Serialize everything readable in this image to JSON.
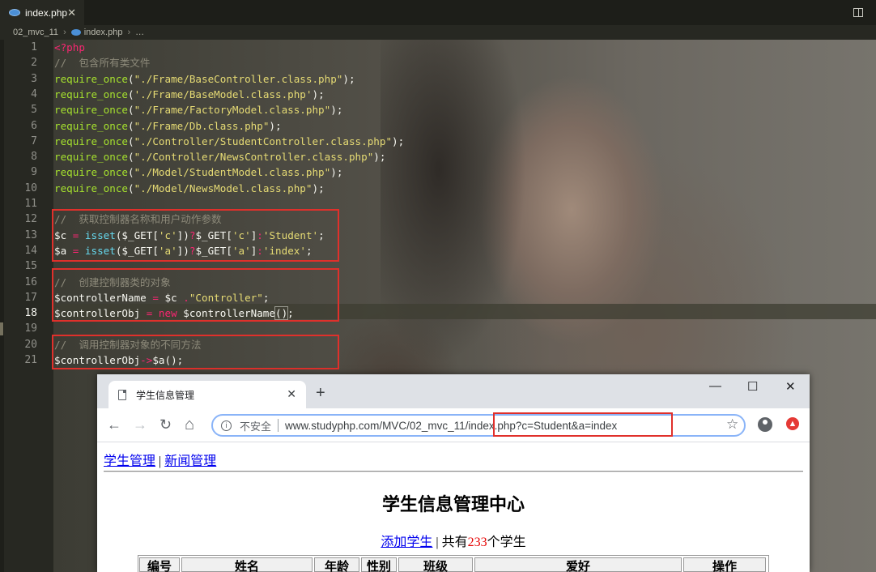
{
  "editor": {
    "tab_title": "index.php",
    "tab_close": "✕",
    "breadcrumb": {
      "folder": "02_mvc_11",
      "file": "index.php",
      "more": "…"
    },
    "lines": [
      {
        "n": "1",
        "tokens": [
          [
            "k-tag",
            "<?php"
          ]
        ]
      },
      {
        "n": "2",
        "tokens": [
          [
            "k-cm",
            "//  包含所有类文件"
          ]
        ]
      },
      {
        "n": "3",
        "tokens": [
          [
            "k-fn",
            "require_once"
          ],
          [
            "k-pn",
            "("
          ],
          [
            "k-str",
            "\"./Frame/BaseController.class.php\""
          ],
          [
            "k-pn",
            ");"
          ]
        ]
      },
      {
        "n": "4",
        "tokens": [
          [
            "k-fn",
            "require_once"
          ],
          [
            "k-pn",
            "("
          ],
          [
            "k-str",
            "'./Frame/BaseModel.class.php'"
          ],
          [
            "k-pn",
            ");"
          ]
        ]
      },
      {
        "n": "5",
        "tokens": [
          [
            "k-fn",
            "require_once"
          ],
          [
            "k-pn",
            "("
          ],
          [
            "k-str",
            "\"./Frame/FactoryModel.class.php\""
          ],
          [
            "k-pn",
            ");"
          ]
        ]
      },
      {
        "n": "6",
        "tokens": [
          [
            "k-fn",
            "require_once"
          ],
          [
            "k-pn",
            "("
          ],
          [
            "k-str",
            "\"./Frame/Db.class.php\""
          ],
          [
            "k-pn",
            ");"
          ]
        ]
      },
      {
        "n": "7",
        "tokens": [
          [
            "k-fn",
            "require_once"
          ],
          [
            "k-pn",
            "("
          ],
          [
            "k-str",
            "\"./Controller/StudentController.class.php\""
          ],
          [
            "k-pn",
            ");"
          ]
        ]
      },
      {
        "n": "8",
        "tokens": [
          [
            "k-fn",
            "require_once"
          ],
          [
            "k-pn",
            "("
          ],
          [
            "k-str",
            "\"./Controller/NewsController.class.php\""
          ],
          [
            "k-pn",
            ");"
          ]
        ]
      },
      {
        "n": "9",
        "tokens": [
          [
            "k-fn",
            "require_once"
          ],
          [
            "k-pn",
            "("
          ],
          [
            "k-str",
            "\"./Model/StudentModel.class.php\""
          ],
          [
            "k-pn",
            ");"
          ]
        ]
      },
      {
        "n": "10",
        "tokens": [
          [
            "k-fn",
            "require_once"
          ],
          [
            "k-pn",
            "("
          ],
          [
            "k-str",
            "\"./Model/NewsModel.class.php\""
          ],
          [
            "k-pn",
            ");"
          ]
        ]
      },
      {
        "n": "11",
        "tokens": []
      },
      {
        "n": "12",
        "tokens": [
          [
            "k-cm",
            "//  获取控制器名称和用户动作参数"
          ]
        ]
      },
      {
        "n": "13",
        "tokens": [
          [
            "k-var",
            "$c"
          ],
          [
            "k-op",
            " = "
          ],
          [
            "k-bi",
            "isset"
          ],
          [
            "k-pn",
            "($_GET["
          ],
          [
            "k-str",
            "'c'"
          ],
          [
            "k-pn",
            "])"
          ],
          [
            "k-op",
            "?"
          ],
          [
            "k-pn",
            "$_GET["
          ],
          [
            "k-str",
            "'c'"
          ],
          [
            "k-pn",
            "]"
          ],
          [
            "k-op",
            ":"
          ],
          [
            "k-str",
            "'Student'"
          ],
          [
            "k-pn",
            ";"
          ]
        ]
      },
      {
        "n": "14",
        "tokens": [
          [
            "k-var",
            "$a"
          ],
          [
            "k-op",
            " = "
          ],
          [
            "k-bi",
            "isset"
          ],
          [
            "k-pn",
            "($_GET["
          ],
          [
            "k-str",
            "'a'"
          ],
          [
            "k-pn",
            "])"
          ],
          [
            "k-op",
            "?"
          ],
          [
            "k-pn",
            "$_GET["
          ],
          [
            "k-str",
            "'a'"
          ],
          [
            "k-pn",
            "]"
          ],
          [
            "k-op",
            ":"
          ],
          [
            "k-str",
            "'index'"
          ],
          [
            "k-pn",
            ";"
          ]
        ]
      },
      {
        "n": "15",
        "tokens": []
      },
      {
        "n": "16",
        "tokens": [
          [
            "k-cm",
            "//  创建控制器类的对象"
          ]
        ]
      },
      {
        "n": "17",
        "tokens": [
          [
            "k-var",
            "$controllerName"
          ],
          [
            "k-op",
            " = "
          ],
          [
            "k-var",
            "$c"
          ],
          [
            "k-op",
            " ."
          ],
          [
            "k-str",
            "\"Controller\""
          ],
          [
            "k-pn",
            ";"
          ]
        ]
      },
      {
        "n": "18",
        "tokens": [
          [
            "k-var",
            "$controllerObj"
          ],
          [
            "k-op",
            " = "
          ],
          [
            "k-new",
            "new"
          ],
          [
            "k-var",
            " $controllerName"
          ],
          [
            "bracket-box",
            "()"
          ],
          [
            "k-pn",
            ";"
          ]
        ]
      },
      {
        "n": "19",
        "tokens": []
      },
      {
        "n": "20",
        "tokens": [
          [
            "k-cm",
            "//  调用控制器对象的不同方法"
          ]
        ]
      },
      {
        "n": "21",
        "tokens": [
          [
            "k-var",
            "$controllerObj"
          ],
          [
            "k-op",
            "->"
          ],
          [
            "k-var",
            "$a"
          ],
          [
            "k-pn",
            "();"
          ]
        ]
      }
    ],
    "active_line": "18"
  },
  "browser": {
    "tab_title": "学生信息管理",
    "tab_close": "✕",
    "new_tab": "+",
    "window_controls": {
      "minimize": "—",
      "maximize": "☐",
      "close": "✕"
    },
    "nav": {
      "back": "←",
      "forward": "→",
      "reload": "↻",
      "home": "⌂"
    },
    "security_label": "不安全",
    "url_host_path": "www.studyphp.com/MVC/02_mvc_11/",
    "url_query": "index.php?c=Student&a=index",
    "bookmark": "☆",
    "page": {
      "nav_link_students": "学生管理",
      "nav_separator": "|",
      "nav_link_news": "新闻管理",
      "title": "学生信息管理中心",
      "add_link": "添加学生",
      "summary_sep": " | 共有",
      "count": "233",
      "summary_suffix": "个学生",
      "table_headers": [
        "编号",
        "姓名",
        "年龄",
        "性别",
        "班级",
        "爱好",
        "操作"
      ]
    }
  }
}
